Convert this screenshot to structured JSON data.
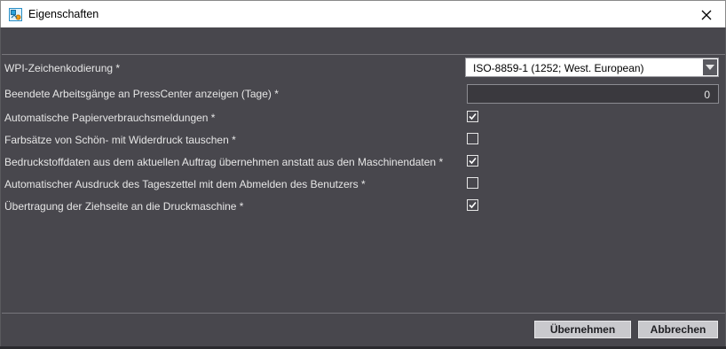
{
  "window": {
    "title": "Eigenschaften",
    "app_icon": "properties-app-icon",
    "close_icon": "close-icon"
  },
  "settings": {
    "encoding": {
      "label": "WPI-Zeichenkodierung *",
      "value": "ISO-8859-1 (1252; West. European)",
      "dropdown_icon": "chevron-down-icon"
    },
    "finished_jobs": {
      "label": "Beendete Arbeitsgänge an PressCenter anzeigen (Tage) *",
      "value": "0"
    },
    "checks": [
      {
        "label": "Automatische Papierverbrauchsmeldungen *",
        "checked": true
      },
      {
        "label": "Farbsätze von Schön- mit Widerdruck tauschen *",
        "checked": false
      },
      {
        "label": "Bedruckstoffdaten aus dem aktuellen Auftrag übernehmen anstatt aus den Maschinendaten *",
        "checked": true
      },
      {
        "label": "Automatischer Ausdruck des Tageszettel mit dem Abmelden des Benutzers *",
        "checked": false
      },
      {
        "label": "Übertragung der Ziehseite an die Druckmaschine *",
        "checked": true
      }
    ]
  },
  "buttons": {
    "apply": "Übernehmen",
    "cancel": "Abbrechen"
  },
  "colors": {
    "background": "#48474d",
    "title_bar": "#ffffff",
    "text": "#e6e6e6",
    "button": "#c9c9cd"
  }
}
